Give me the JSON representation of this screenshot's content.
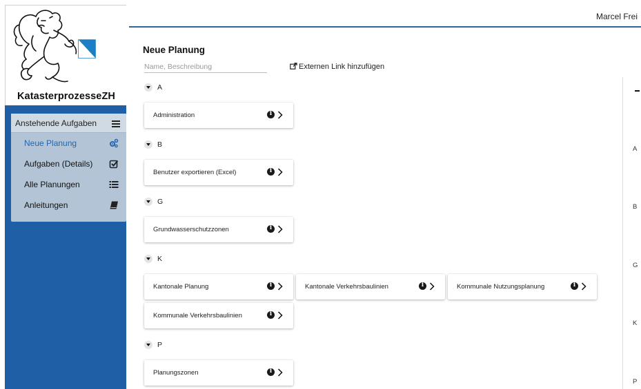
{
  "app": {
    "brand": "KatasterprozesseZH"
  },
  "header": {
    "user_name": "Marcel Frei"
  },
  "sidebar": {
    "menu_title": "Anstehende Aufgaben",
    "items": [
      {
        "label": "Neue Planung",
        "icon": "gears-icon",
        "active": true
      },
      {
        "label": "Aufgaben (Details)",
        "icon": "check-square-icon",
        "active": false
      },
      {
        "label": "Alle Planungen",
        "icon": "list-icon",
        "active": false
      },
      {
        "label": "Anleitungen",
        "icon": "book-icon",
        "active": false
      }
    ]
  },
  "main": {
    "title": "Neue Planung",
    "search_placeholder": "Name, Beschreibung",
    "external_link_label": "Externen Link hinzufügen",
    "groups": [
      {
        "letter": "A",
        "cards": [
          "Administration"
        ]
      },
      {
        "letter": "B",
        "cards": [
          "Benutzer exportieren (Excel)"
        ]
      },
      {
        "letter": "G",
        "cards": [
          "Grundwasserschutzzonen"
        ]
      },
      {
        "letter": "K",
        "cards": [
          "Kantonale Planung",
          "Kantonale Verkehrsbaulinien",
          "Kommunale Nutzungsplanung",
          "Kommunale Verkehrsbaulinien"
        ]
      },
      {
        "letter": "P",
        "cards": [
          "Planungszonen"
        ]
      }
    ]
  },
  "index": {
    "letters": [
      "A",
      "B",
      "G",
      "K",
      "P"
    ]
  },
  "colors": {
    "sidebar_blue": "#1f5fa5",
    "menu_bg": "#b3c4d6",
    "active_text": "#2466ac",
    "header_rule": "#2d62a0"
  }
}
